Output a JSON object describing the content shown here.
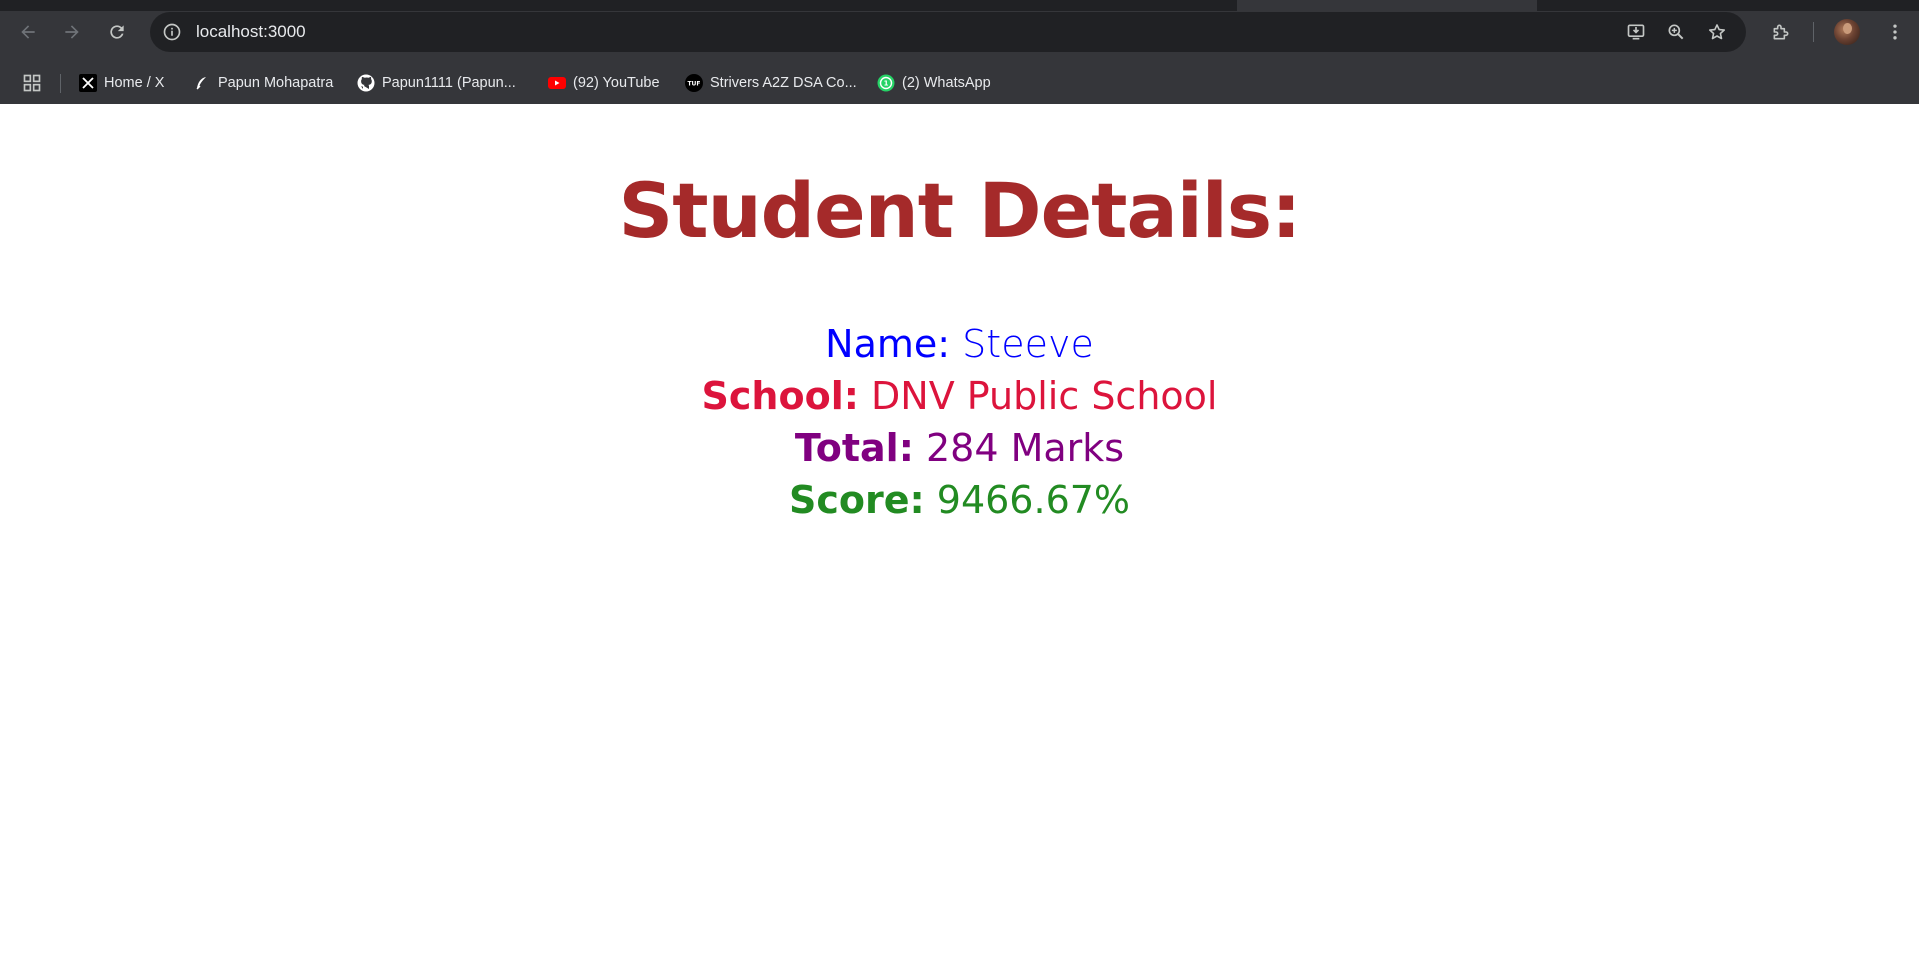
{
  "browser": {
    "address_bar": {
      "url": "localhost:3000"
    },
    "bookmarks": [
      {
        "label": "Home / X",
        "icon": "x-logo-icon"
      },
      {
        "label": "Papun Mohapatra",
        "icon": "feather-icon"
      },
      {
        "label": "Papun1111 (Papun...",
        "icon": "github-icon"
      },
      {
        "label": "(92) YouTube",
        "icon": "youtube-icon"
      },
      {
        "label": "Strivers A2Z DSA Co...",
        "icon": "tuf-icon"
      },
      {
        "label": "(2) WhatsApp",
        "icon": "whatsapp-icon"
      }
    ],
    "colors": {
      "toolbar": "#35363a",
      "omnibox": "#202124",
      "text": "#e8eaed",
      "icon": "#c4c7c5"
    }
  },
  "page": {
    "title": "Student Details:",
    "title_color": "#a52a2a",
    "details": {
      "name": {
        "label": "Name:",
        "value": "Steeve",
        "color": "#0000ff"
      },
      "school": {
        "label": "School:",
        "value": "DNV Public School",
        "color": "#dc143c"
      },
      "total": {
        "label": "Total:",
        "value": "284 Marks",
        "color": "#800080"
      },
      "score": {
        "label": "Score:",
        "value": "9466.67%",
        "color": "#228b22"
      }
    }
  }
}
